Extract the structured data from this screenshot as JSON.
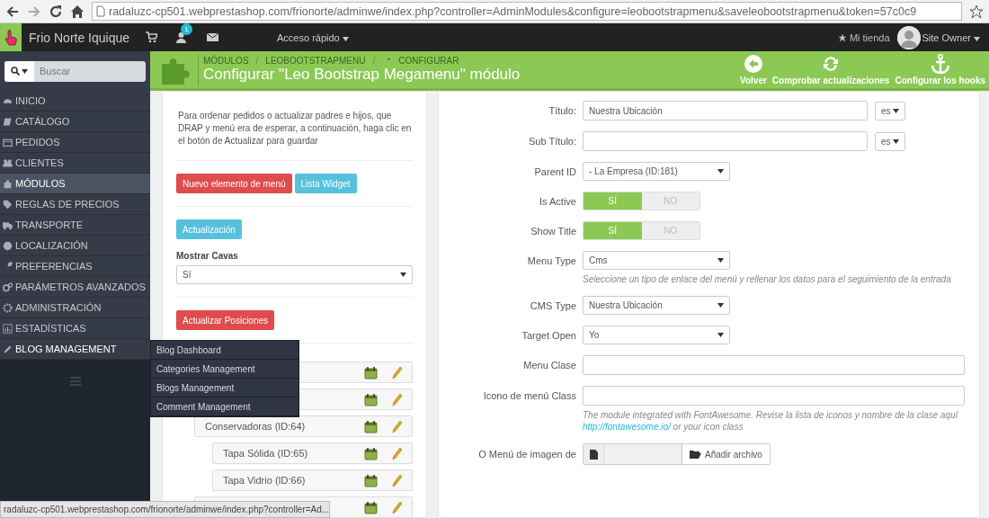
{
  "browser": {
    "url": "radaluzc-cp501.webprestashop.com/frionorte/adminwe/index.php?controller=AdminModules&configure=leobootstrapmenu&saveleobootstrapmenu&token=57c0c9"
  },
  "topbar": {
    "shop_name": "Frio Norte Iquique",
    "notification_count": "1",
    "quick_access": "Acceso rápido",
    "my_shop": "Mi tienda",
    "user": "Site Owner"
  },
  "sidebar": {
    "search_placeholder": "Buscar",
    "items": [
      {
        "label": "INICIO",
        "selected": false
      },
      {
        "label": "CATÁLOGO",
        "selected": false
      },
      {
        "label": "PEDIDOS",
        "selected": false
      },
      {
        "label": "CLIENTES",
        "selected": false
      },
      {
        "label": "MÓDULOS",
        "selected": true
      },
      {
        "label": "REGLAS DE PRECIOS",
        "selected": false
      },
      {
        "label": "TRANSPORTE",
        "selected": false
      },
      {
        "label": "LOCALIZACIÓN",
        "selected": false
      },
      {
        "label": "PREFERENCIAS",
        "selected": false
      },
      {
        "label": "PARÁMETROS AVANZADOS",
        "selected": false
      },
      {
        "label": "ADMINISTRACIÓN",
        "selected": false
      },
      {
        "label": "ESTADÍSTICAS",
        "selected": false
      },
      {
        "label": "BLOG MANAGEMENT",
        "selected": false,
        "expanded": true
      }
    ]
  },
  "flyout": {
    "items": [
      "Blog Dashboard",
      "Categories Management",
      "Blogs Management",
      "Comment Management"
    ]
  },
  "header": {
    "separator": "/",
    "breadcrumb": [
      "MÓDULOS",
      "LEOBOOTSTRAPMENU",
      "CONFIGURAR"
    ],
    "title": "Configurar \"Leo Bootstrap Megamenu\" módulo",
    "actions": [
      {
        "label": "Volver"
      },
      {
        "label": "Comprobar actualizaciones"
      },
      {
        "label": "Configurar los hooks"
      }
    ]
  },
  "left_panel": {
    "help_text": "Para ordenar pedidos o actualizar padres e hijos, que DRAP y menú era de esperar, a continuación, haga clic en el botón de Actualizar para guardar",
    "buttons": [
      {
        "label": "Nuevo elemento de menú",
        "kind": "danger"
      },
      {
        "label": "Lista Widget",
        "kind": "info"
      }
    ],
    "update_button": {
      "label": "Actualización",
      "kind": "info"
    },
    "show_canvas": {
      "label": "Mostrar Cavas",
      "value": "Sí"
    },
    "positions_button": {
      "label": "Actualizar Posiciones",
      "kind": "danger"
    },
    "tree": [
      {
        "kind": "item"
      },
      {
        "kind": "item",
        "children": [
          {
            "kind": "item",
            "label": "Conservadoras (ID:64)",
            "children": [
              {
                "kind": "item",
                "label": "Tapa Sólida (ID:65)"
              },
              {
                "kind": "item",
                "label": "Tapa Vidrio (ID:66)"
              }
            ]
          },
          {
            "kind": "item"
          }
        ]
      }
    ]
  },
  "form": {
    "fields": [
      {
        "kind": "text",
        "label": "Título:",
        "value": "Nuestra Ubicación",
        "lang": "es"
      },
      {
        "kind": "text",
        "label": "Sub Título:",
        "lang": "es"
      },
      {
        "kind": "select",
        "label": "Parent ID",
        "value": "- La Empresa (ID:181)"
      },
      {
        "kind": "switch",
        "label": "Is Active",
        "on": true,
        "on_label": "SÍ",
        "off_label": "NO"
      },
      {
        "kind": "switch",
        "label": "Show Title",
        "on": true,
        "on_label": "SÍ",
        "off_label": "NO"
      },
      {
        "kind": "select",
        "label": "Menu Type",
        "value": "Cms",
        "help": "Seleccione un tipo de enlace del menú y rellenar los datos para el seguimiento de la entrada"
      },
      {
        "kind": "select",
        "label": "CMS Type",
        "value": "Nuestra Ubicación"
      },
      {
        "kind": "select",
        "label": "Target Open",
        "value": "Yo"
      },
      {
        "kind": "wide",
        "label": "Menu Clase"
      },
      {
        "kind": "wide",
        "label": "Icono de menú Class",
        "help": "The module integrated with FontAwesome. Revise la lista de iconos y nombre de la clase aquí",
        "help_link": "http://fontawesome.io/",
        "help_after": " or your icon class"
      },
      {
        "kind": "file",
        "label": "O Menú de imagen de",
        "button": "Añadir archivo"
      }
    ]
  },
  "status_bar": "radaluzc-cp501.webprestashop.com/frionorte/adminwe/index.php?controller=Ad..."
}
